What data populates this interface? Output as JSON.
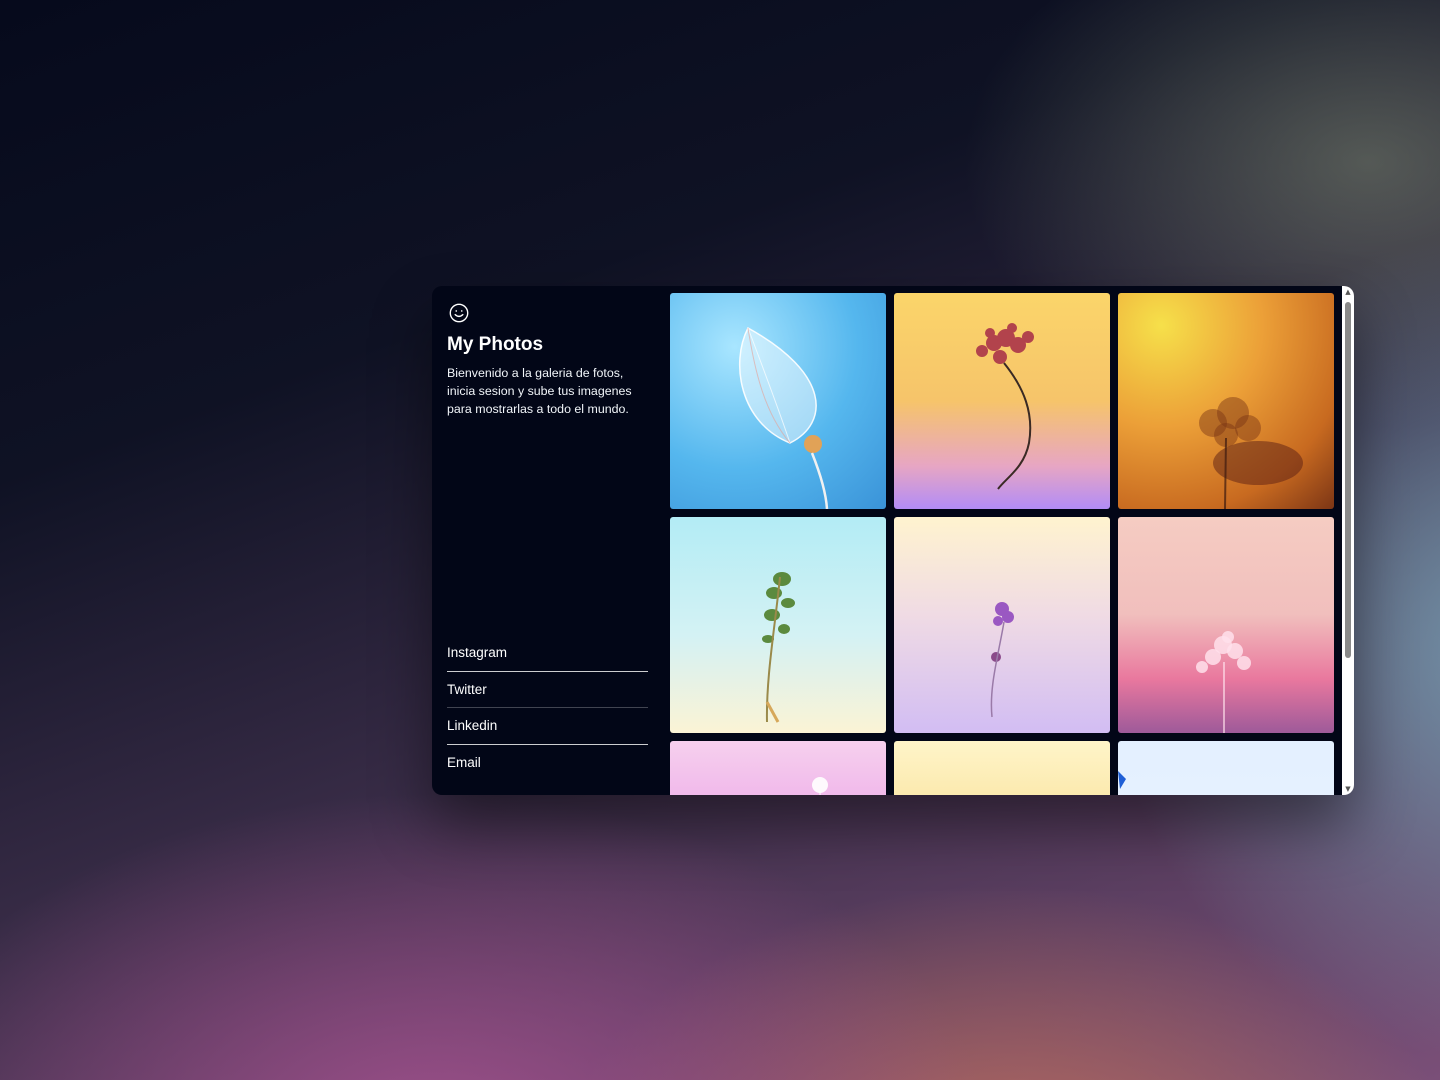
{
  "app": {
    "title": "My Photos",
    "description": "Bienvenido a la galeria de fotos, inicia sesion y sube tus imagenes para mostrarlas a todo el mundo.",
    "logo_icon": "smile-icon"
  },
  "links": [
    {
      "label": "Instagram"
    },
    {
      "label": "Twitter"
    },
    {
      "label": "Linkedin"
    },
    {
      "label": "Email"
    }
  ],
  "gallery": {
    "photos": [
      {
        "subject": "translucent seed pod",
        "colors": [
          "#7fd0f5",
          "#3aa0e0"
        ]
      },
      {
        "subject": "dried fern flower",
        "colors": [
          "#f9c85a",
          "#b48bf5"
        ]
      },
      {
        "subject": "blurred plant silhouette",
        "colors": [
          "#f3d23a",
          "#c05f1e"
        ]
      },
      {
        "subject": "green dried sprig",
        "colors": [
          "#aeeaf3",
          "#fbf4d6"
        ]
      },
      {
        "subject": "purple dried flower",
        "colors": [
          "#fff4d0",
          "#c9b3f3"
        ]
      },
      {
        "subject": "pink plant silhouette",
        "colors": [
          "#f7c8c0",
          "#b05fa5"
        ]
      },
      {
        "subject": "pink flower",
        "colors": [
          "#f4c3e9",
          "#d36fe0"
        ]
      },
      {
        "subject": "yellow gradient",
        "colors": [
          "#fff4c8",
          "#f3cf78"
        ]
      },
      {
        "subject": "blue sky",
        "colors": [
          "#dfefff",
          "#eaf3ff"
        ]
      }
    ]
  }
}
